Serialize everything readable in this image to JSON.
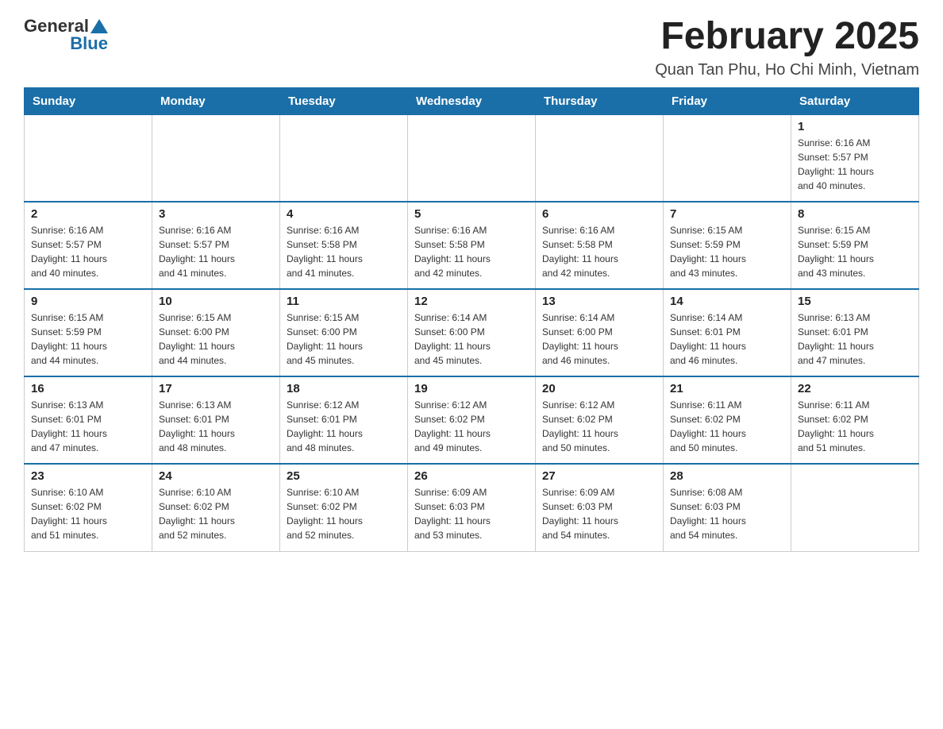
{
  "header": {
    "logo_general": "General",
    "logo_blue": "Blue",
    "month_title": "February 2025",
    "location": "Quan Tan Phu, Ho Chi Minh, Vietnam"
  },
  "days_of_week": [
    "Sunday",
    "Monday",
    "Tuesday",
    "Wednesday",
    "Thursday",
    "Friday",
    "Saturday"
  ],
  "weeks": [
    [
      {
        "day": "",
        "info": ""
      },
      {
        "day": "",
        "info": ""
      },
      {
        "day": "",
        "info": ""
      },
      {
        "day": "",
        "info": ""
      },
      {
        "day": "",
        "info": ""
      },
      {
        "day": "",
        "info": ""
      },
      {
        "day": "1",
        "info": "Sunrise: 6:16 AM\nSunset: 5:57 PM\nDaylight: 11 hours\nand 40 minutes."
      }
    ],
    [
      {
        "day": "2",
        "info": "Sunrise: 6:16 AM\nSunset: 5:57 PM\nDaylight: 11 hours\nand 40 minutes."
      },
      {
        "day": "3",
        "info": "Sunrise: 6:16 AM\nSunset: 5:57 PM\nDaylight: 11 hours\nand 41 minutes."
      },
      {
        "day": "4",
        "info": "Sunrise: 6:16 AM\nSunset: 5:58 PM\nDaylight: 11 hours\nand 41 minutes."
      },
      {
        "day": "5",
        "info": "Sunrise: 6:16 AM\nSunset: 5:58 PM\nDaylight: 11 hours\nand 42 minutes."
      },
      {
        "day": "6",
        "info": "Sunrise: 6:16 AM\nSunset: 5:58 PM\nDaylight: 11 hours\nand 42 minutes."
      },
      {
        "day": "7",
        "info": "Sunrise: 6:15 AM\nSunset: 5:59 PM\nDaylight: 11 hours\nand 43 minutes."
      },
      {
        "day": "8",
        "info": "Sunrise: 6:15 AM\nSunset: 5:59 PM\nDaylight: 11 hours\nand 43 minutes."
      }
    ],
    [
      {
        "day": "9",
        "info": "Sunrise: 6:15 AM\nSunset: 5:59 PM\nDaylight: 11 hours\nand 44 minutes."
      },
      {
        "day": "10",
        "info": "Sunrise: 6:15 AM\nSunset: 6:00 PM\nDaylight: 11 hours\nand 44 minutes."
      },
      {
        "day": "11",
        "info": "Sunrise: 6:15 AM\nSunset: 6:00 PM\nDaylight: 11 hours\nand 45 minutes."
      },
      {
        "day": "12",
        "info": "Sunrise: 6:14 AM\nSunset: 6:00 PM\nDaylight: 11 hours\nand 45 minutes."
      },
      {
        "day": "13",
        "info": "Sunrise: 6:14 AM\nSunset: 6:00 PM\nDaylight: 11 hours\nand 46 minutes."
      },
      {
        "day": "14",
        "info": "Sunrise: 6:14 AM\nSunset: 6:01 PM\nDaylight: 11 hours\nand 46 minutes."
      },
      {
        "day": "15",
        "info": "Sunrise: 6:13 AM\nSunset: 6:01 PM\nDaylight: 11 hours\nand 47 minutes."
      }
    ],
    [
      {
        "day": "16",
        "info": "Sunrise: 6:13 AM\nSunset: 6:01 PM\nDaylight: 11 hours\nand 47 minutes."
      },
      {
        "day": "17",
        "info": "Sunrise: 6:13 AM\nSunset: 6:01 PM\nDaylight: 11 hours\nand 48 minutes."
      },
      {
        "day": "18",
        "info": "Sunrise: 6:12 AM\nSunset: 6:01 PM\nDaylight: 11 hours\nand 48 minutes."
      },
      {
        "day": "19",
        "info": "Sunrise: 6:12 AM\nSunset: 6:02 PM\nDaylight: 11 hours\nand 49 minutes."
      },
      {
        "day": "20",
        "info": "Sunrise: 6:12 AM\nSunset: 6:02 PM\nDaylight: 11 hours\nand 50 minutes."
      },
      {
        "day": "21",
        "info": "Sunrise: 6:11 AM\nSunset: 6:02 PM\nDaylight: 11 hours\nand 50 minutes."
      },
      {
        "day": "22",
        "info": "Sunrise: 6:11 AM\nSunset: 6:02 PM\nDaylight: 11 hours\nand 51 minutes."
      }
    ],
    [
      {
        "day": "23",
        "info": "Sunrise: 6:10 AM\nSunset: 6:02 PM\nDaylight: 11 hours\nand 51 minutes."
      },
      {
        "day": "24",
        "info": "Sunrise: 6:10 AM\nSunset: 6:02 PM\nDaylight: 11 hours\nand 52 minutes."
      },
      {
        "day": "25",
        "info": "Sunrise: 6:10 AM\nSunset: 6:02 PM\nDaylight: 11 hours\nand 52 minutes."
      },
      {
        "day": "26",
        "info": "Sunrise: 6:09 AM\nSunset: 6:03 PM\nDaylight: 11 hours\nand 53 minutes."
      },
      {
        "day": "27",
        "info": "Sunrise: 6:09 AM\nSunset: 6:03 PM\nDaylight: 11 hours\nand 54 minutes."
      },
      {
        "day": "28",
        "info": "Sunrise: 6:08 AM\nSunset: 6:03 PM\nDaylight: 11 hours\nand 54 minutes."
      },
      {
        "day": "",
        "info": ""
      }
    ]
  ]
}
